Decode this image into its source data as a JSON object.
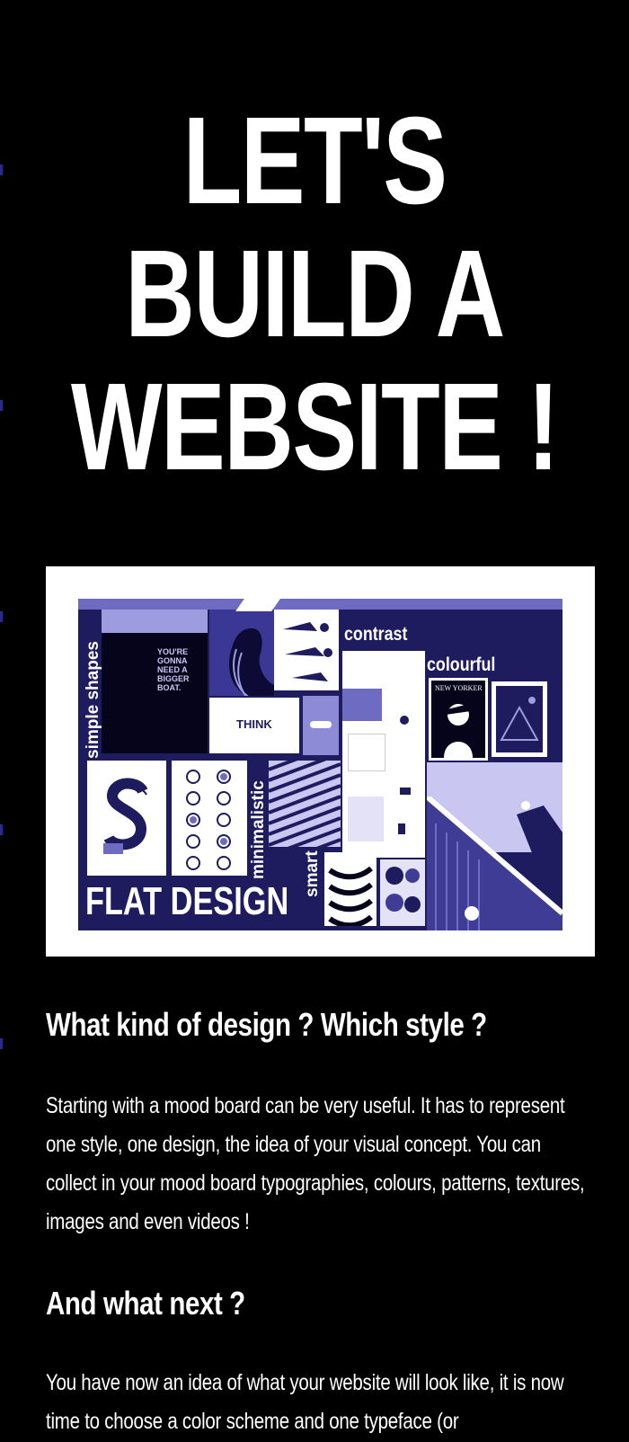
{
  "hero": {
    "lines": [
      "LET'S",
      "BUILD A",
      "WEBSITE !"
    ]
  },
  "moodboard": {
    "labels": {
      "simple_shapes": "simple shapes",
      "contrast": "contrast",
      "colourful": "colourful",
      "minimalistic": "minimalistic",
      "smart": "smart",
      "flat_design": "FLAT DESIGN"
    },
    "poster_text": [
      "YOU'RE",
      "GONNA",
      "NEED A",
      "BIGGER",
      "BOAT."
    ],
    "think_text": "THINK",
    "magazine_title": "NEW YORKER",
    "colors": {
      "board_bg": "#1e1b5e",
      "accent_purple": "#6d6bc2",
      "light_purple": "#c9c7f2",
      "frame": "#ffffff"
    }
  },
  "section1": {
    "heading": "What kind of design ? Which style ?",
    "body": "Starting with a mood board can be very useful. It has to represent one style, one design, the idea of your visual concept. You can collect in your mood board typographies, colours, patterns, textures, images and even videos !"
  },
  "section2": {
    "heading": "And what next ?",
    "body": "You have now an idea of what your website will look like, it is now time to choose a color scheme and one typeface (or"
  }
}
